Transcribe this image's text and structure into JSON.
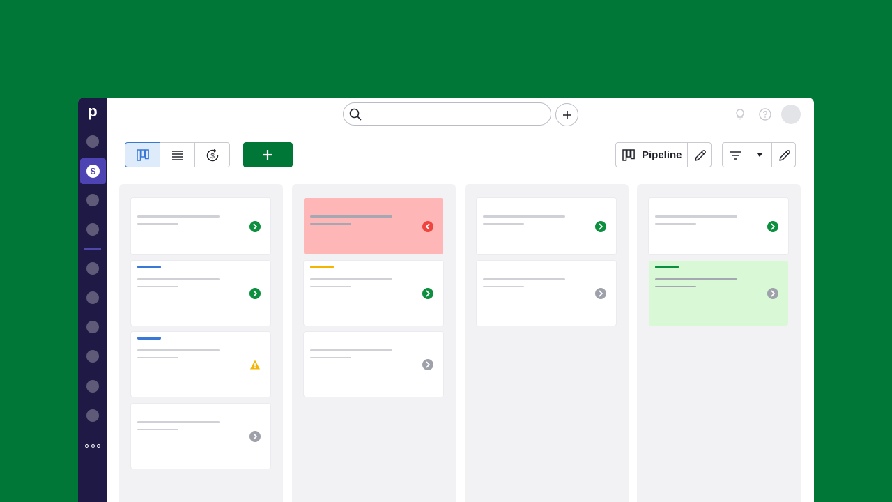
{
  "app": {
    "logo_letter": "p",
    "colors": {
      "background": "#017737",
      "sidebar": "#1f1a45",
      "sidebar_active": "#4d43b3",
      "primary_button": "#017737",
      "status_green": "#0c8f3e",
      "status_grey": "#9ea1a9",
      "status_red": "#f0443f",
      "status_warning": "#f5b400",
      "rotten_card": "#ffb6b6",
      "won_card": "#d9f8d6",
      "tag_blue": "#3a78d8",
      "tag_yellow": "#f5b400",
      "tag_green": "#0c8f3e"
    }
  },
  "sidebar": {
    "items": [
      {
        "icon": "nav-dot-icon",
        "active": false
      },
      {
        "icon": "deals-dollar-icon",
        "active": true
      },
      {
        "icon": "nav-dot-icon",
        "active": false
      },
      {
        "icon": "nav-dot-icon",
        "active": false
      },
      {
        "icon": "nav-dot-icon",
        "active": false
      },
      {
        "icon": "nav-dot-icon",
        "active": false
      },
      {
        "icon": "nav-dot-icon",
        "active": false
      },
      {
        "icon": "nav-dot-icon",
        "active": false
      },
      {
        "icon": "nav-dot-icon",
        "active": false
      },
      {
        "icon": "nav-dot-icon",
        "active": false
      }
    ],
    "more_icon": "more-dots-icon"
  },
  "header": {
    "search": {
      "value": "",
      "placeholder": "",
      "icon": "search-icon"
    },
    "quick_add_icon": "plus-icon",
    "icons": [
      "lightbulb-icon",
      "help-icon"
    ],
    "avatar": "avatar"
  },
  "toolbar": {
    "views": [
      {
        "icon": "kanban-icon",
        "active": true
      },
      {
        "icon": "list-icon",
        "active": false
      },
      {
        "icon": "forecast-icon",
        "active": false
      }
    ],
    "add_icon": "plus-icon",
    "pipeline_label": "Pipeline",
    "pipeline_icon": "kanban-icon",
    "edit_icon": "pencil-icon",
    "filter_icon": "filter-icon",
    "filter_caret_icon": "caret-down-icon"
  },
  "board": {
    "columns": [
      {
        "cards": [
          {
            "variant": "default",
            "tag": null,
            "status": "green"
          },
          {
            "variant": "default",
            "tag": "blue",
            "status": "green"
          },
          {
            "variant": "default",
            "tag": "blue",
            "status": "warning"
          },
          {
            "variant": "default",
            "tag": null,
            "status": "grey"
          }
        ]
      },
      {
        "cards": [
          {
            "variant": "rotten",
            "tag": null,
            "status": "red"
          },
          {
            "variant": "default",
            "tag": "yellow",
            "status": "green"
          },
          {
            "variant": "default",
            "tag": null,
            "status": "grey"
          }
        ]
      },
      {
        "cards": [
          {
            "variant": "default",
            "tag": null,
            "status": "green"
          },
          {
            "variant": "default",
            "tag": null,
            "status": "grey"
          }
        ]
      },
      {
        "cards": [
          {
            "variant": "default",
            "tag": null,
            "status": "green"
          },
          {
            "variant": "won",
            "tag": "green",
            "status": "grey"
          }
        ]
      }
    ]
  }
}
